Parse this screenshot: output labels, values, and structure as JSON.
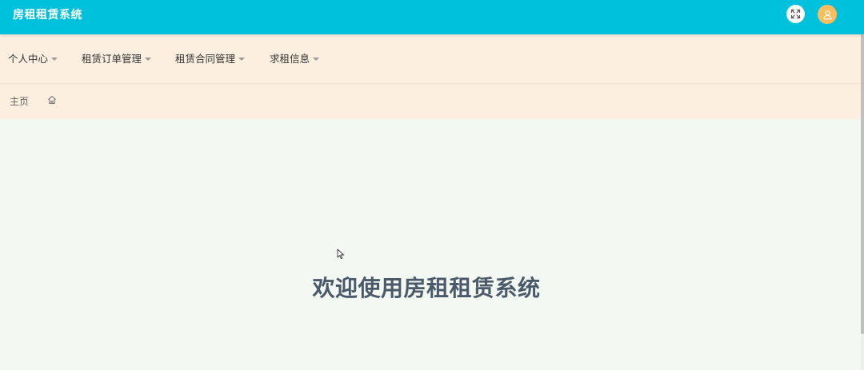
{
  "header": {
    "app_title": "房租租赁系统",
    "fullscreen_icon": "fullscreen-icon",
    "avatar_icon": "user-icon",
    "colors": {
      "background": "#00c1dc",
      "avatar": "#fdbd5e"
    }
  },
  "navbar": {
    "items": [
      {
        "label": "个人中心"
      },
      {
        "label": "租赁订单管理"
      },
      {
        "label": "租赁合同管理"
      },
      {
        "label": "求租信息"
      }
    ],
    "background": "#fdefe0"
  },
  "breadcrumb": {
    "home_label": "主页",
    "home_icon": "home-icon"
  },
  "main": {
    "welcome_text": "欢迎使用房租租赁系统",
    "background": "#f4f8f3"
  }
}
